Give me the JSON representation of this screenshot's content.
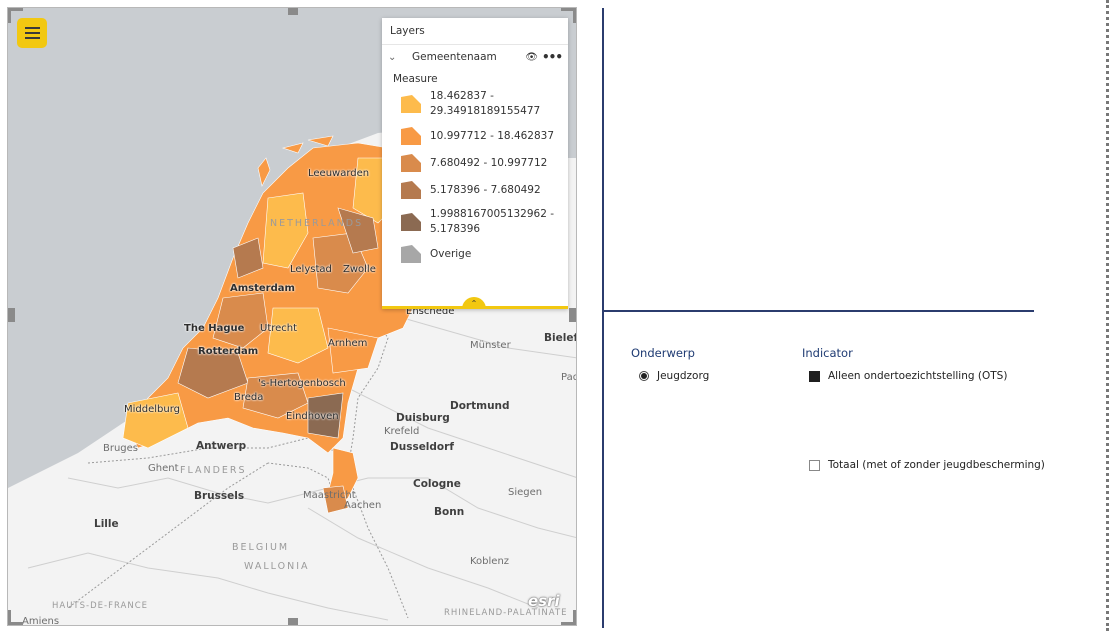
{
  "map": {
    "layers_panel": {
      "title": "Layers",
      "layer_name": "Gemeentenaam",
      "measure_label": "Measure",
      "legend": [
        {
          "label_line1": "18.462837 -",
          "label_line2": "29.34918189155477",
          "color": "#fdbb4c"
        },
        {
          "label_line1": "10.997712 - 18.462837",
          "label_line2": "",
          "color": "#f89a45"
        },
        {
          "label_line1": "7.680492 - 10.997712",
          "label_line2": "",
          "color": "#d98b4c"
        },
        {
          "label_line1": "5.178396 - 7.680492",
          "label_line2": "",
          "color": "#b57a4f"
        },
        {
          "label_line1": "1.9988167005132962 -",
          "label_line2": "5.178396",
          "color": "#8b6a52"
        },
        {
          "label_line1": "Overige",
          "label_line2": "",
          "color": "#a7a7a7"
        }
      ]
    },
    "labels": {
      "leeuwarden": "Leeuwarden",
      "netherlands": "NETHERLANDS",
      "lelystad": "Lelystad",
      "zwolle": "Zwolle",
      "amsterdam": "Amsterdam",
      "enschede": "Enschede",
      "the_hague": "The Hague",
      "utrecht": "Utrecht",
      "rotterdam": "Rotterdam",
      "arnhem": "Arnhem",
      "munster": "Münster",
      "bielefeld": "Bielefe",
      "s_hertogenbosch": "'s-Hertogenbosch",
      "middelburg": "Middelburg",
      "breda": "Breda",
      "eindhoven": "Eindhoven",
      "duisburg": "Duisburg",
      "dortmund": "Dortmund",
      "krefeld": "Krefeld",
      "bruges": "Bruges",
      "antwerp": "Antwerp",
      "dusseldorf": "Dusseldorf",
      "ghent": "Ghent",
      "flanders": "FLANDERS",
      "brussels": "Brussels",
      "maastricht": "Maastricht",
      "aachen": "Aachen",
      "cologne": "Cologne",
      "siegen": "Siegen",
      "lille": "Lille",
      "bonn": "Bonn",
      "belgium": "BELGIUM",
      "wallonia": "WALLONIA",
      "koblenz": "Koblenz",
      "hauts_de_france": "HAUTS-DE-FRANCE",
      "rhineland": "RHINELAND-PALATINATE",
      "amiens": "Amiens",
      "pad": "Pad",
      "esri": "esri"
    }
  },
  "slicers": {
    "onderwerp": {
      "title": "Onderwerp",
      "options": [
        {
          "label": "Jeugdzorg",
          "selected": true
        }
      ]
    },
    "indicator": {
      "title": "Indicator",
      "options": [
        {
          "label": "Alleen ondertoezichtstelling (OTS)",
          "checked": true
        },
        {
          "label": "Totaal (met of zonder jeugdbescherming)",
          "checked": false
        }
      ]
    }
  }
}
